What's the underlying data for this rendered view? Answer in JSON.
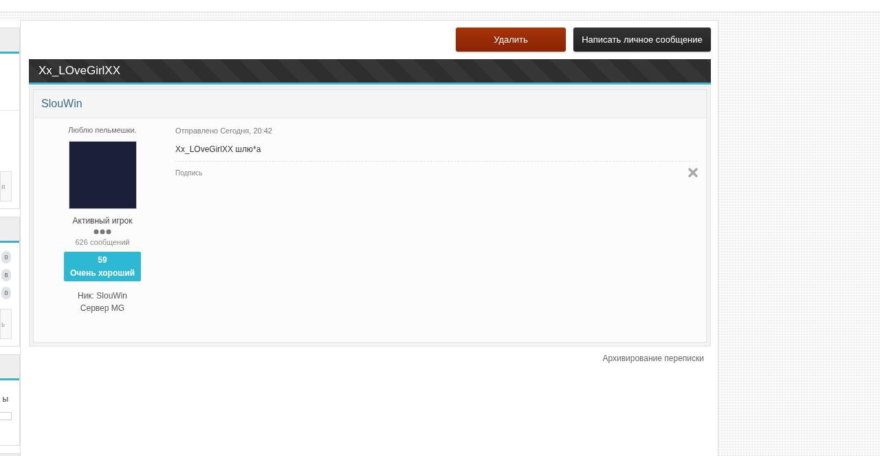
{
  "sidebar": {
    "panels": [
      {
        "fragments": [
          "я"
        ]
      },
      {
        "badges": [
          "0",
          "8",
          "0"
        ],
        "fragments": [
          "ь"
        ]
      },
      {
        "fragments": [
          "ы"
        ],
        "has_input": true
      }
    ]
  },
  "actions": [
    {
      "label": "Удалить",
      "kind": "danger"
    },
    {
      "label": "Написать личное сообщение",
      "kind": "dark"
    }
  ],
  "conversation": {
    "title": "Xx_LOveGirlXX"
  },
  "message": {
    "author": "SlouWin",
    "status": "Люблю пельмешки.",
    "rank": "Активный игрок",
    "post_count": "626 сообщений",
    "reputation": {
      "score": "59",
      "label": "Очень хороший"
    },
    "extra_lines": [
      "Ник: SlouWin",
      "Сервер MG"
    ],
    "sent": "Отправлено Сегодня, 20:42",
    "body": "Xx_LOveGirlXX шлю*а",
    "signature_label": "Подпись"
  },
  "footer_link": "Архивирование переписки"
}
